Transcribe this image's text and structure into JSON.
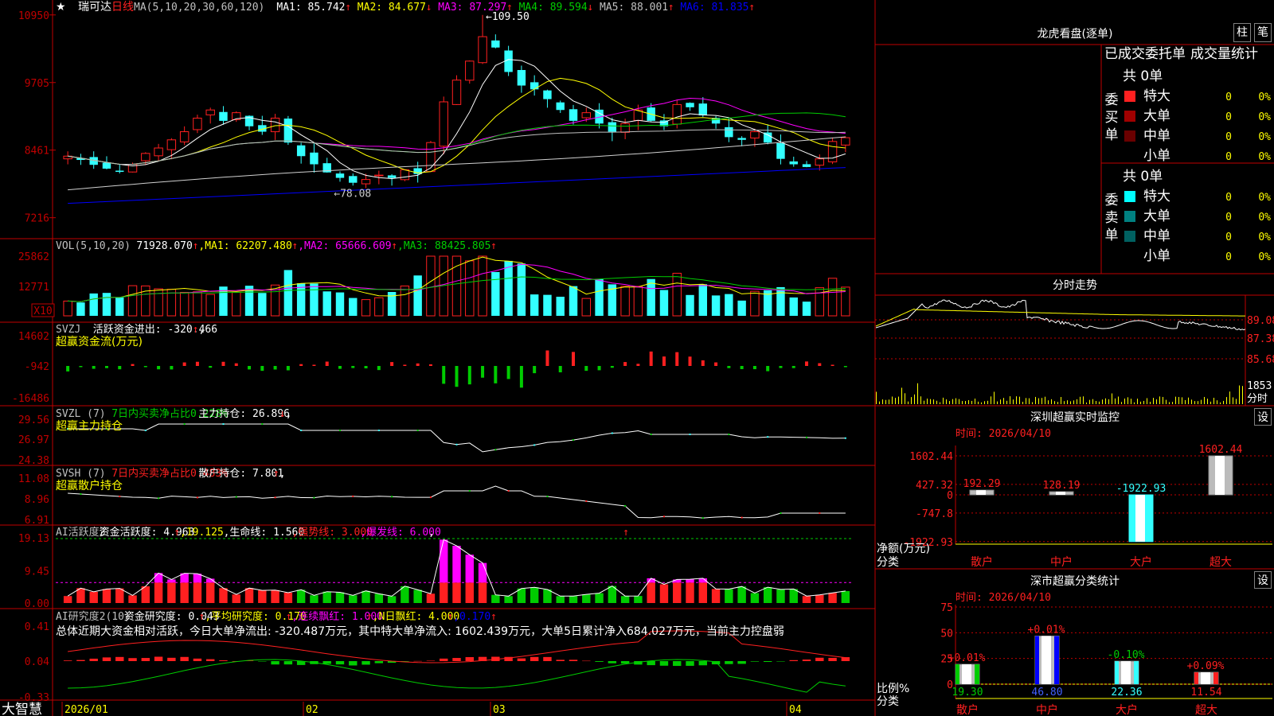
{
  "colors": {
    "up": "#ff2020",
    "down": "#33ffff",
    "frame": "#c00000",
    "ma1": "#ffffff",
    "ma2": "#ffff00",
    "ma3": "#ff00ff",
    "ma4": "#00cc00",
    "ma5": "#c0c0c0",
    "ma6": "#0000ff",
    "green": "#00cc00",
    "magenta": "#ff00ff",
    "yellow": "#ffff00"
  },
  "footer": {
    "brand": "大智慧",
    "x_labels": [
      "2026/01",
      "02",
      "03",
      "04"
    ]
  },
  "main": {
    "star": "★",
    "stock": "瑞可达",
    "period": "日线",
    "ma_params": "MA(5,10,20,30,60,120)",
    "ma": [
      {
        "label": "MA1: 85.742",
        "arrow": "↑"
      },
      {
        "label": "MA2: 84.677",
        "arrow": "↓"
      },
      {
        "label": "MA3: 87.297",
        "arrow": "↑"
      },
      {
        "label": "MA4: 89.594",
        "arrow": "↓"
      },
      {
        "label": "MA5: 88.001",
        "arrow": "↑"
      },
      {
        "label": "MA6: 81.835",
        "arrow": "↑"
      }
    ],
    "y_ticks": [
      "10950",
      "9705",
      "8461",
      "7216"
    ],
    "high_note": "109.50",
    "low_note": "78.08"
  },
  "vol": {
    "header": "VOL(5,10,20)",
    "value": "71928.070",
    "arrow": "↑",
    "ma": [
      {
        "label": "MA1: 62207.480",
        "arrow": "↑"
      },
      {
        "label": "MA2: 65666.609",
        "arrow": "↑"
      },
      {
        "label": "MA3: 88425.805",
        "arrow": "↑"
      }
    ],
    "y_ticks": [
      "25862",
      "12771"
    ],
    "unit": "X10"
  },
  "svzj": {
    "header": "SVZJ",
    "l1": "活跃资金进出: -320.466",
    "arrow": "↑",
    "l2": "超赢资金流(万元)",
    "y_ticks": [
      "14602",
      "-942",
      "-16486"
    ]
  },
  "svzl": {
    "header": "SVZL (7)",
    "l1": "7日内买卖净占比0.228%",
    "l2": "主力持仓: 26.896",
    "arrow": "↓",
    "l3": "超赢主力持仓",
    "y_ticks": [
      "29.56",
      "26.97",
      "24.38"
    ]
  },
  "svsh": {
    "header": "SVSH (7)",
    "l1": "7日内买卖净占比0.483%",
    "l2": "散户持仓: 7.801",
    "arrow": "↑",
    "l3": "超赢散户持仓",
    "y_ticks": [
      "11.08",
      "8.96",
      "6.91"
    ]
  },
  "ai1": {
    "header": "AI活跃度2",
    "l1": "资金活跃度: 4.963",
    "a1": "↑",
    "l2": ",19.125",
    "l3": ",生命线: 1.560",
    "l4": ",强势线: 3.000",
    "l5": ",爆发线: 6.000",
    "l6": ",",
    "y_ticks": [
      "19.13",
      "9.45",
      "0.00"
    ]
  },
  "ai2": {
    "header": "AI研究度2(10)",
    "l1": "资金研究度: 0.043",
    "a1": "↑",
    "l2": ",平均研究度: 0.170",
    "a2": "↑",
    "l3": ",连续飘红: 1.000",
    "a3": "↑",
    "l4": ",N日飘红: 4.000",
    "a4": "↑",
    "l5": ",0.170",
    "a5": "↑",
    "summary": "总体近期大资金相对活跃，今日大单净流出: -320.487万元，其中特大单净流入: 1602.439万元，大单5日累计净入684.027万元，当前主力控盘弱",
    "y_ticks": [
      "0.41",
      "0.04",
      "-0.33"
    ]
  },
  "dragon": {
    "title": "龙虎看盘(逐单)",
    "btn_zhu": "柱",
    "btn_bi": "笔",
    "tab_active": "已成交委托单",
    "tab_other": "成交量统计",
    "buy": {
      "side": "委买单",
      "total": "共 0单",
      "rows": [
        {
          "name": "特大",
          "n": "0",
          "p": "0%",
          "color": "#ff2020"
        },
        {
          "name": "大单",
          "n": "0",
          "p": "0%",
          "color": "#a00000"
        },
        {
          "name": "中单",
          "n": "0",
          "p": "0%",
          "color": "#6a0000"
        },
        {
          "name": "小单",
          "n": "0",
          "p": "0%",
          "color": ""
        }
      ]
    },
    "sell": {
      "side": "委卖单",
      "total": "共 0单",
      "rows": [
        {
          "name": "特大",
          "n": "0",
          "p": "0%",
          "color": "#00ffff"
        },
        {
          "name": "大单",
          "n": "0",
          "p": "0%",
          "color": "#008080"
        },
        {
          "name": "中单",
          "n": "0",
          "p": "0%",
          "color": "#006060"
        },
        {
          "name": "小单",
          "n": "0",
          "p": "0%",
          "color": ""
        }
      ]
    }
  },
  "intraday": {
    "title": "分时走势",
    "y_ticks": [
      "89.08",
      "87.38",
      "85.68"
    ],
    "vol_label": "1853",
    "unit": "分时"
  },
  "monitor": {
    "title": "深圳超赢实时监控",
    "btn": "设",
    "time": "时间: 2026/04/10",
    "ylabel": "净额(万元)",
    "xlabel": "分类",
    "chart_data": {
      "type": "bar",
      "categories": [
        "散户",
        "中户",
        "大户",
        "超大"
      ],
      "values": [
        192.29,
        128.19,
        -1922.93,
        1602.44
      ],
      "y_ticks": [
        "1602.44",
        "427.32",
        "0",
        "-747.8",
        "-1922.93"
      ]
    }
  },
  "classify": {
    "title": "深市超赢分类统计",
    "btn": "设",
    "time": "时间: 2026/04/10",
    "ylabel": "比例%",
    "xlabel": "分类",
    "chart_data": {
      "type": "bar",
      "categories": [
        "散户",
        "中户",
        "大户",
        "超大"
      ],
      "values": [
        19.3,
        46.8,
        22.36,
        11.54
      ],
      "changes": [
        "+0.01%",
        "+0.01%",
        "-0.10%",
        "+0.09%"
      ],
      "y_ticks": [
        "75",
        "50",
        "25",
        "0"
      ]
    }
  }
}
